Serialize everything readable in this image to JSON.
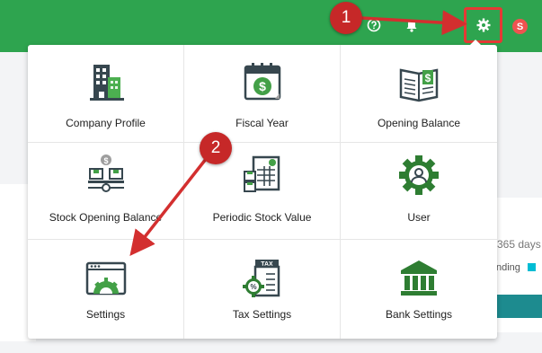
{
  "header": {
    "avatar_letter": "S",
    "icons": [
      "help-icon",
      "bell-icon",
      "apps-icon",
      "gear-icon"
    ],
    "accent": "#2ea44f"
  },
  "background": {
    "days_text": "365 days",
    "legend_text": "nding"
  },
  "settings_menu": {
    "items": [
      {
        "label": "Company Profile",
        "icon": "company-building-icon"
      },
      {
        "label": "Fiscal Year",
        "icon": "calendar-dollar-icon"
      },
      {
        "label": "Opening Balance",
        "icon": "ledger-book-icon"
      },
      {
        "label": "Stock Opening Balance",
        "icon": "stock-boxes-icon"
      },
      {
        "label": "Periodic Stock Value",
        "icon": "stock-sheet-icon"
      },
      {
        "label": "User",
        "icon": "user-gear-icon"
      },
      {
        "label": "Settings",
        "icon": "window-gear-icon"
      },
      {
        "label": "Tax Settings",
        "icon": "tax-document-icon"
      },
      {
        "label": "Bank Settings",
        "icon": "bank-icon"
      }
    ]
  },
  "annotations": {
    "marker_1": "1",
    "marker_2": "2",
    "color": "#d32f2f"
  }
}
